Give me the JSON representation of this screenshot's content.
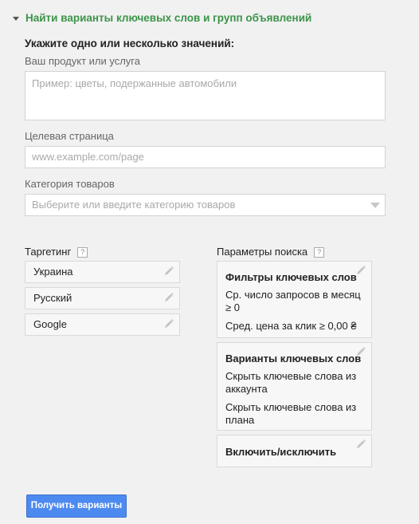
{
  "section": {
    "title": "Найти варианты ключевых слов и групп объявлений"
  },
  "form": {
    "heading": "Укажите одно или несколько значений:",
    "product_label": "Ваш продукт или услуга",
    "product_placeholder": "Пример: цветы, подержанные автомобили",
    "landing_label": "Целевая страница",
    "landing_placeholder": "www.example.com/page",
    "category_label": "Категория товаров",
    "category_placeholder": "Выберите или введите категорию товаров"
  },
  "targeting": {
    "label": "Таргетинг",
    "help": "?",
    "items": [
      "Украина",
      "Русский",
      "Google"
    ]
  },
  "search_params": {
    "label": "Параметры поиска",
    "help": "?",
    "cards": [
      {
        "title": "Фильтры ключевых слов",
        "lines": [
          "Ср. число запросов в месяц ≥ 0",
          "Сред. цена за клик ≥ 0,00 ₴"
        ]
      },
      {
        "title": "Варианты ключевых слов",
        "lines": [
          "Скрыть ключевые слова из аккаунта",
          "Скрыть ключевые слова из плана"
        ]
      },
      {
        "title": "Включить/исключить",
        "lines": []
      }
    ]
  },
  "actions": {
    "submit_label": "Получить варианты"
  },
  "colors": {
    "accent_green": "#3b9449",
    "button_blue": "#4d8af0"
  }
}
